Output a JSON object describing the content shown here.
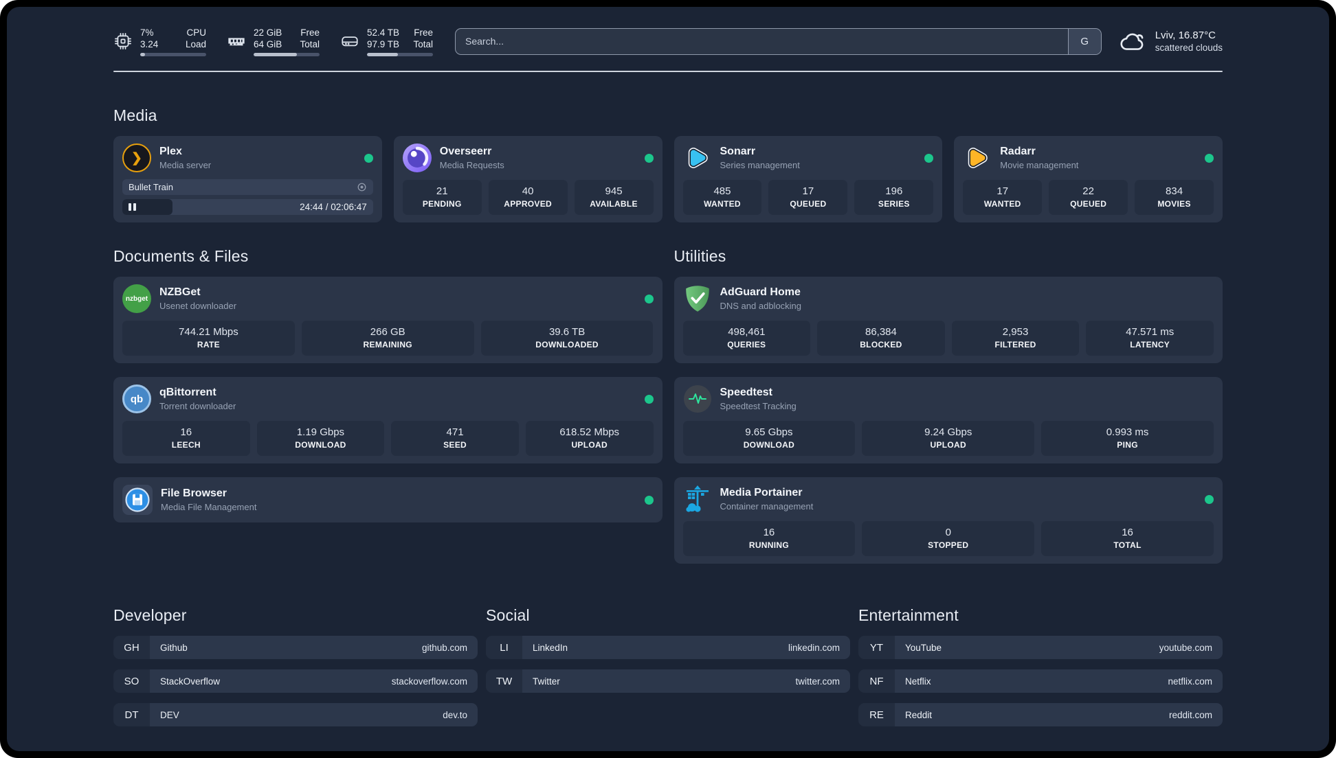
{
  "colors": {
    "background": "#1b2435",
    "card": "#2b3548",
    "stat_pill": "#242e40",
    "status_online": "#1cc68c",
    "plex_accent": "#e8a00d"
  },
  "header": {
    "system_stats": [
      {
        "icon": "cpu-icon",
        "value_top": "7%",
        "value_bottom": "3.24",
        "label_top": "CPU",
        "label_bottom": "Load",
        "percent": 7
      },
      {
        "icon": "ram-icon",
        "value_top": "22 GiB",
        "value_bottom": "64 GiB",
        "label_top": "Free",
        "label_bottom": "Total",
        "percent": 66
      },
      {
        "icon": "disk-icon",
        "value_top": "52.4 TB",
        "value_bottom": "97.9 TB",
        "label_top": "Free",
        "label_bottom": "Total",
        "percent": 47
      }
    ],
    "search": {
      "placeholder": "Search...",
      "provider_button": "G"
    },
    "weather": {
      "location": "Lviv, 16.87°C",
      "condition": "scattered clouds"
    }
  },
  "icons": {
    "plex_glyph": "❯",
    "nzbget_text": "nzbget",
    "qbittorrent_text": "qb"
  },
  "sections": {
    "media": {
      "title": "Media",
      "plex": {
        "name": "Plex",
        "subtitle": "Media server",
        "online": true,
        "now_playing": {
          "title": "Bullet Train",
          "state": "paused",
          "elapsed": "24:44",
          "duration": "02:06:47",
          "time_display": "24:44 / 02:06:47",
          "progress_percent": 20
        }
      },
      "apps": [
        {
          "name": "Overseerr",
          "subtitle": "Media Requests",
          "online": true,
          "stats": [
            {
              "value": "21",
              "label": "PENDING"
            },
            {
              "value": "40",
              "label": "APPROVED"
            },
            {
              "value": "945",
              "label": "AVAILABLE"
            }
          ]
        },
        {
          "name": "Sonarr",
          "subtitle": "Series management",
          "online": true,
          "stats": [
            {
              "value": "485",
              "label": "WANTED"
            },
            {
              "value": "17",
              "label": "QUEUED"
            },
            {
              "value": "196",
              "label": "SERIES"
            }
          ]
        },
        {
          "name": "Radarr",
          "subtitle": "Movie management",
          "online": true,
          "stats": [
            {
              "value": "17",
              "label": "WANTED"
            },
            {
              "value": "22",
              "label": "QUEUED"
            },
            {
              "value": "834",
              "label": "MOVIES"
            }
          ]
        }
      ]
    },
    "documents": {
      "title": "Documents & Files",
      "apps": [
        {
          "name": "NZBGet",
          "subtitle": "Usenet downloader",
          "online": true,
          "stats": [
            {
              "value": "744.21 Mbps",
              "label": "RATE"
            },
            {
              "value": "266 GB",
              "label": "REMAINING"
            },
            {
              "value": "39.6 TB",
              "label": "DOWNLOADED"
            }
          ]
        },
        {
          "name": "qBittorrent",
          "subtitle": "Torrent downloader",
          "online": true,
          "stats": [
            {
              "value": "16",
              "label": "LEECH"
            },
            {
              "value": "1.19 Gbps",
              "label": "DOWNLOAD"
            },
            {
              "value": "471",
              "label": "SEED"
            },
            {
              "value": "618.52 Mbps",
              "label": "UPLOAD"
            }
          ]
        },
        {
          "name": "File Browser",
          "subtitle": "Media File Management",
          "online": true,
          "stats": []
        }
      ]
    },
    "utilities": {
      "title": "Utilities",
      "apps": [
        {
          "name": "AdGuard Home",
          "subtitle": "DNS and adblocking",
          "stats": [
            {
              "value": "498,461",
              "label": "QUERIES"
            },
            {
              "value": "86,384",
              "label": "BLOCKED"
            },
            {
              "value": "2,953",
              "label": "FILTERED"
            },
            {
              "value": "47.571 ms",
              "label": "LATENCY"
            }
          ]
        },
        {
          "name": "Speedtest",
          "subtitle": "Speedtest Tracking",
          "stats": [
            {
              "value": "9.65 Gbps",
              "label": "DOWNLOAD"
            },
            {
              "value": "9.24 Gbps",
              "label": "UPLOAD"
            },
            {
              "value": "0.993 ms",
              "label": "PING"
            }
          ]
        },
        {
          "name": "Media Portainer",
          "subtitle": "Container management",
          "online": true,
          "stats": [
            {
              "value": "16",
              "label": "RUNNING"
            },
            {
              "value": "0",
              "label": "STOPPED"
            },
            {
              "value": "16",
              "label": "TOTAL"
            }
          ]
        }
      ]
    },
    "bookmarks": [
      {
        "title": "Developer",
        "links": [
          {
            "abbr": "GH",
            "name": "Github",
            "url": "github.com"
          },
          {
            "abbr": "SO",
            "name": "StackOverflow",
            "url": "stackoverflow.com"
          },
          {
            "abbr": "DT",
            "name": "DEV",
            "url": "dev.to"
          }
        ]
      },
      {
        "title": "Social",
        "links": [
          {
            "abbr": "LI",
            "name": "LinkedIn",
            "url": "linkedin.com"
          },
          {
            "abbr": "TW",
            "name": "Twitter",
            "url": "twitter.com"
          }
        ]
      },
      {
        "title": "Entertainment",
        "links": [
          {
            "abbr": "YT",
            "name": "YouTube",
            "url": "youtube.com"
          },
          {
            "abbr": "NF",
            "name": "Netflix",
            "url": "netflix.com"
          },
          {
            "abbr": "RE",
            "name": "Reddit",
            "url": "reddit.com"
          }
        ]
      }
    ]
  }
}
